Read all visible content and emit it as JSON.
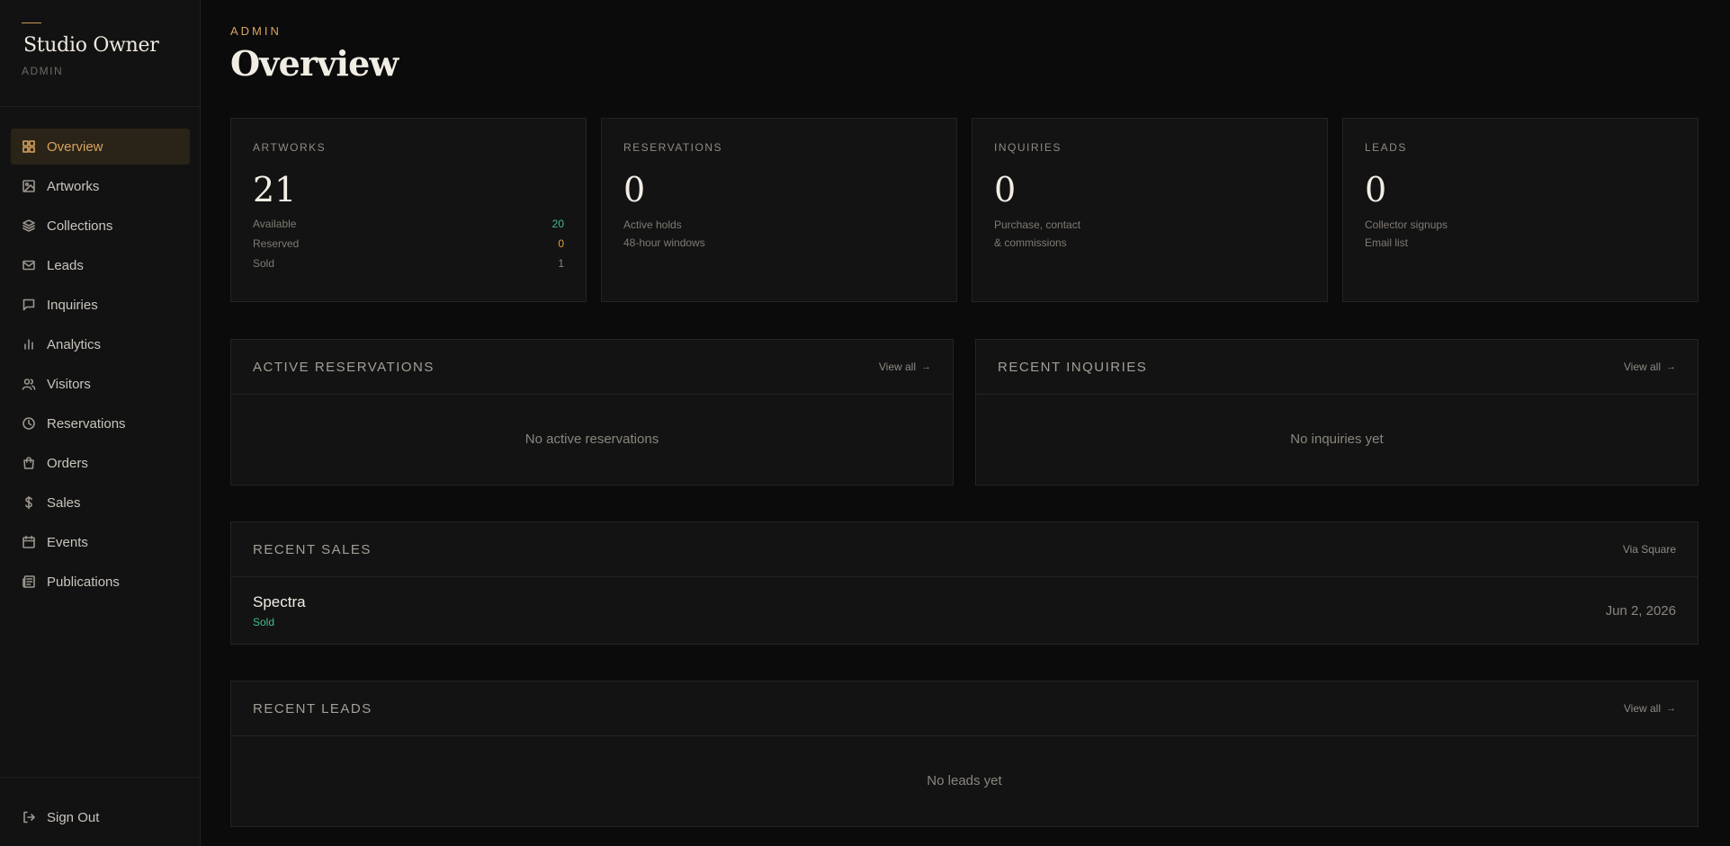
{
  "brand": {
    "title": "Studio Owner",
    "subtitle": "ADMIN"
  },
  "sidebar": {
    "items": [
      {
        "label": "Overview",
        "icon": "grid-icon",
        "active": true
      },
      {
        "label": "Artworks",
        "icon": "image-icon"
      },
      {
        "label": "Collections",
        "icon": "layers-icon"
      },
      {
        "label": "Leads",
        "icon": "mail-icon"
      },
      {
        "label": "Inquiries",
        "icon": "message-icon"
      },
      {
        "label": "Analytics",
        "icon": "bar-chart-icon"
      },
      {
        "label": "Visitors",
        "icon": "users-icon"
      },
      {
        "label": "Reservations",
        "icon": "clock-icon"
      },
      {
        "label": "Orders",
        "icon": "shopping-bag-icon"
      },
      {
        "label": "Sales",
        "icon": "dollar-icon"
      },
      {
        "label": "Events",
        "icon": "calendar-icon"
      },
      {
        "label": "Publications",
        "icon": "newspaper-icon"
      }
    ],
    "signout": "Sign Out"
  },
  "header": {
    "kicker": "ADMIN",
    "title": "Overview"
  },
  "stats": {
    "artworks": {
      "label": "ARTWORKS",
      "value": "21",
      "rows": [
        {
          "label": "Available",
          "value": "20"
        },
        {
          "label": "Reserved",
          "value": "0"
        },
        {
          "label": "Sold",
          "value": "1"
        }
      ]
    },
    "reservations": {
      "label": "RESERVATIONS",
      "value": "0",
      "desc1": "Active holds",
      "desc2": "48-hour windows"
    },
    "inquiries": {
      "label": "INQUIRIES",
      "value": "0",
      "desc1": "Purchase, contact",
      "desc2": "& commissions"
    },
    "leads": {
      "label": "LEADS",
      "value": "0",
      "desc1": "Collector signups",
      "desc2": "Email list"
    }
  },
  "panels": {
    "active_reservations": {
      "title": "ACTIVE RESERVATIONS",
      "link": "View all",
      "empty": "No active reservations"
    },
    "recent_inquiries": {
      "title": "RECENT INQUIRIES",
      "link": "View all",
      "empty": "No inquiries yet"
    },
    "recent_sales": {
      "title": "RECENT SALES",
      "link": "Via Square",
      "rows": [
        {
          "name": "Spectra",
          "status": "Sold",
          "date": "Jun 2, 2026"
        }
      ]
    },
    "recent_leads": {
      "title": "RECENT LEADS",
      "link": "View all",
      "empty": "No leads yet"
    }
  },
  "colors": {
    "accent": "#d9a35e",
    "green": "#3fbf8a",
    "orange": "#e69b3a",
    "background": "#0b0b0b"
  }
}
